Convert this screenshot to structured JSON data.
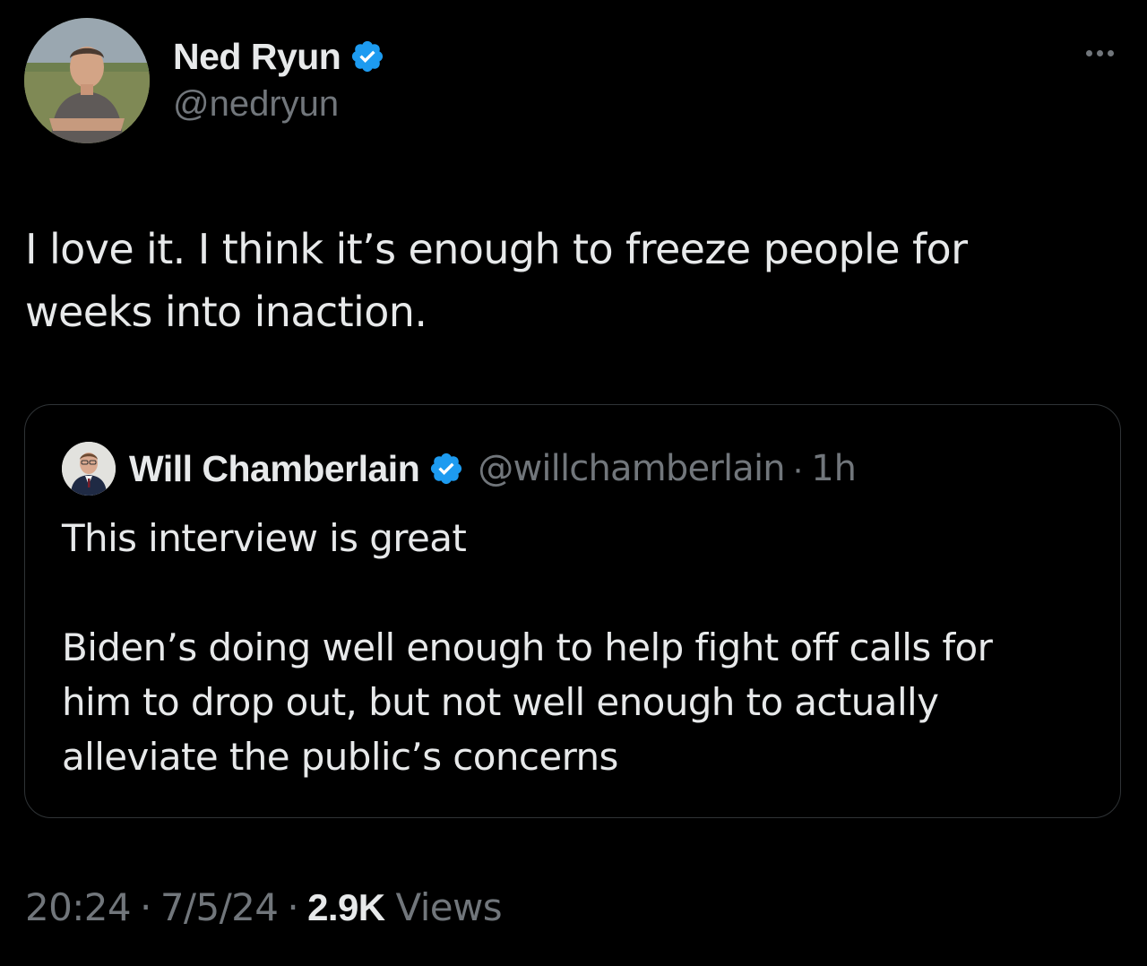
{
  "author": {
    "display_name": "Ned Ryun",
    "handle": "@nedryun",
    "verified": true,
    "avatar_icon": "profile-photo"
  },
  "tweet": {
    "text_line1": "I love it. I think it’s enough to freeze people for",
    "text_line2": "weeks into inaction."
  },
  "quoted_tweet": {
    "display_name": "Will Chamberlain",
    "handle": "@willchamberlain",
    "separator": "·",
    "time_ago": "1h",
    "verified": true,
    "line1": "This interview is great",
    "line2": "Biden’s doing well enough to help fight off calls for",
    "line3": "him to drop out, but not well enough to actually",
    "line4": "alleviate the public’s concerns"
  },
  "meta": {
    "time": "20:24",
    "separator": "·",
    "date": "7/5/24",
    "views_count": "2.9K",
    "views_label": "Views"
  },
  "colors": {
    "background": "#000000",
    "primary_text": "#e7e9ea",
    "secondary_text": "#71767b",
    "border": "#2f3336",
    "verified_badge": "#1d9bf0"
  }
}
